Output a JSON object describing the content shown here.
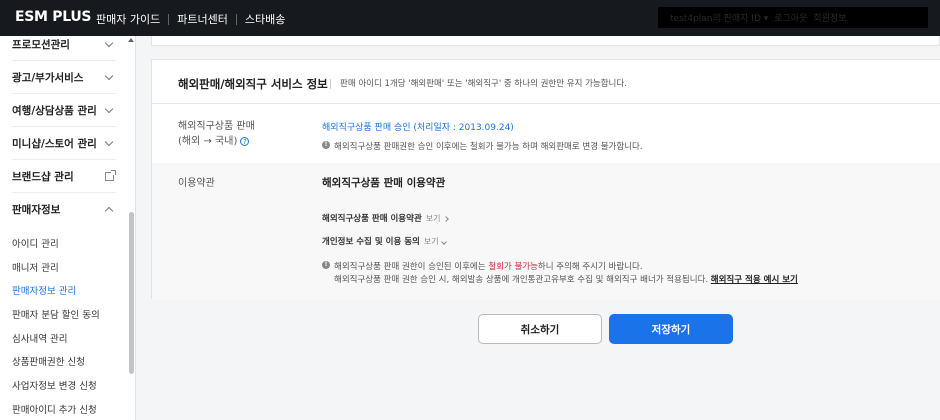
{
  "header": {
    "logo": "ESM PLUS",
    "nav": [
      "판매자 가이드",
      "파트너센터",
      "스타배송"
    ],
    "user": [
      "test4plan의 판매자 ID ▾",
      "로그아웃",
      "회원정보"
    ]
  },
  "sidebar": {
    "sections": [
      {
        "label": "프로모션관리"
      },
      {
        "label": "광고/부가서비스"
      },
      {
        "label": "여행/상담상품 관리"
      },
      {
        "label": "미니샵/스토어 관리"
      },
      {
        "label": "브랜드샵 관리"
      },
      {
        "label": "판매자정보"
      }
    ],
    "sub_items": [
      {
        "label": "아이디 관리"
      },
      {
        "label": "매니저 관리"
      },
      {
        "label": "판매자정보 관리"
      },
      {
        "label": "판매자 분담 할인 동의"
      },
      {
        "label": "심사내역 관리"
      },
      {
        "label": "상품판매권한 신청"
      },
      {
        "label": "사업자정보 변경 신청"
      },
      {
        "label": "판매아이디 추가 신청"
      }
    ],
    "active_item": "판매자정보 관리"
  },
  "main": {
    "section_title": "해외판매/해외직구 서비스 정보",
    "section_desc": "판매 아이디 1개당 '해외판매' 또는 '해외직구' 중 하나의 권한만 유지 가능합니다.",
    "row1": {
      "label_line1": "해외직구상품 판매",
      "label_line2": "(해외 → 국내)",
      "help_icon": "?",
      "status": "해외직구상품 판매 승인 (처리일자 : 2013.09.24)",
      "note": "해외직구상품 판매권한 승인 이후에는 철회가 불가능 하며 해외판매로 변경 불가합니다."
    },
    "row2": {
      "label": "이용약관",
      "title": "해외직구상품 판매 이용약관",
      "terms": [
        {
          "label": "해외직구상품 판매 이용약관",
          "view": "보기"
        },
        {
          "label": "개인정보 수집 및 이용 동의",
          "view": "보기"
        }
      ],
      "note1_pre": "해외직구상품 판매 권한이 승인된 이후에는 ",
      "note1_red": "철회가 불가능",
      "note1_post": "하니 주의해 주시기 바랍니다.",
      "note2_pre": "해외직구상품 판매 권한 승인 시, 해외발송 상품에 개인통관고유부호 수집 및 해외직구 배너가 적용됩니다. ",
      "note2_link": "해외직구 적용 예시 보기"
    }
  },
  "actions": {
    "cancel": "취소하기",
    "save": "저장하기"
  },
  "colors": {
    "accent": "#1a73e8",
    "warning": "#e0243a",
    "topbar": "#16191e"
  }
}
